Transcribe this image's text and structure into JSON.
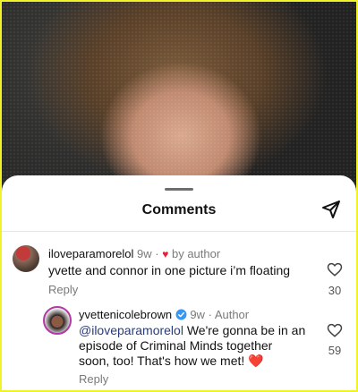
{
  "sheet": {
    "title": "Comments"
  },
  "comments": [
    {
      "username": "iloveparamorelol",
      "age": "9w",
      "dot": "·",
      "by_author": "by author",
      "text": "yvette and connor in one picture i’m floating",
      "reply_label": "Reply",
      "likes": "30"
    },
    {
      "username": "yvettenicolebrown",
      "age": "9w",
      "dot": "·",
      "author_tag": "Author",
      "mention": "@iloveparamorelol",
      "text_line1_rest": " We're gonna be in an",
      "text_line2": "episode of Criminal Minds together",
      "text_line3": "soon, too! That's how we met! ",
      "emoji": "❤️",
      "reply_label": "Reply",
      "likes": "59"
    }
  ],
  "colors": {
    "highlight_border": "#f2f22a",
    "mention": "#2b3c7a",
    "heart": "#e0223a",
    "verified": "#3897f0"
  }
}
